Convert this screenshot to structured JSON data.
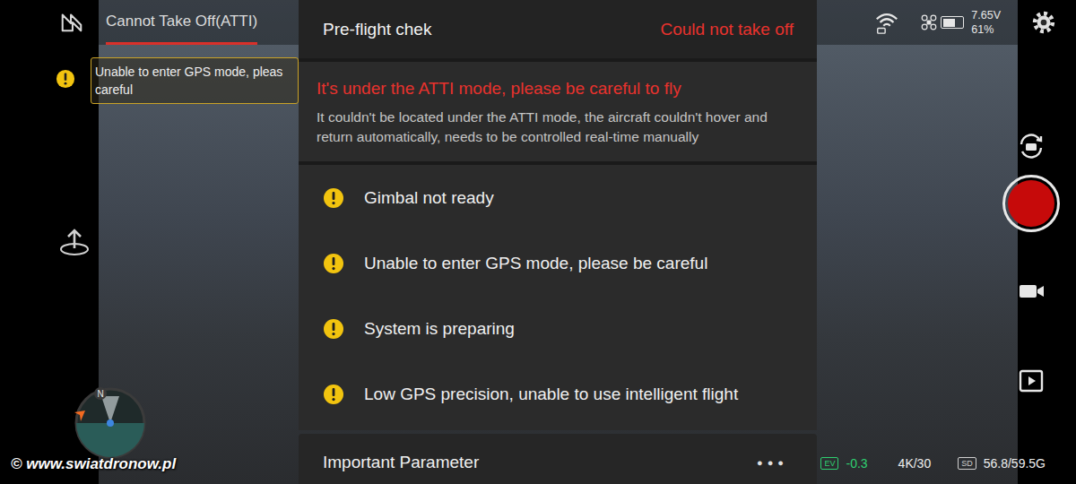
{
  "top_bar": {
    "title": "Cannot Take Off(ATTI)",
    "battery": {
      "voltage": "7.65V",
      "percent": "61%",
      "level": 0.61
    }
  },
  "toast": {
    "lines": [
      "Unable to enter GPS mode, pleas",
      "careful"
    ]
  },
  "preflight": {
    "title": "Pre-flight chek",
    "status": "Could not take off",
    "alert": {
      "title": "It's under the ATTI mode, please be careful to fly",
      "description": "It couldn't be located under the ATTI mode, the aircraft couldn't hover and return automatically, needs to be controlled real-time manually"
    },
    "checks": [
      {
        "label": "Gimbal not ready"
      },
      {
        "label": "Unable to enter GPS mode, please be careful"
      },
      {
        "label": "System is preparing"
      },
      {
        "label": "Low GPS precision, unable to use intelligent flight"
      }
    ],
    "footer": {
      "label": "Important Parameter",
      "more": "●●●"
    }
  },
  "compass": {
    "north": "N"
  },
  "camera_status": {
    "ev_label": "EV",
    "ev": "-0.3",
    "format": "4K/30",
    "storage_label": "SD",
    "storage": "56.8/59.5G"
  },
  "watermark": "© www.swiatdronow.pl"
}
